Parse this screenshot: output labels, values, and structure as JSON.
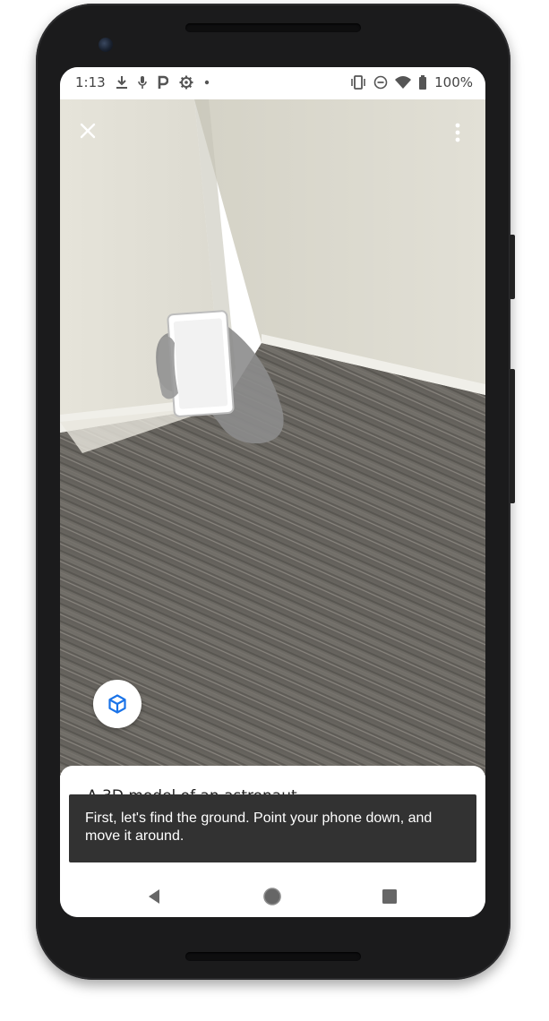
{
  "status_bar": {
    "time": "1:13",
    "left_icons": [
      "download-icon",
      "mic-icon",
      "parking-icon",
      "settings-icon",
      "dot-icon"
    ],
    "right_icons": [
      "vibrate-icon",
      "do-not-disturb-icon",
      "wifi-icon",
      "battery-icon"
    ],
    "battery": "100%"
  },
  "ar_view": {
    "close_icon": "close-icon",
    "more_icon": "more-vert-icon",
    "view_3d_icon": "cube-icon",
    "accent_color": "#1a73e8",
    "hint_graphic": "hand-holding-phone"
  },
  "bottom_sheet": {
    "title": "A 3D model of an astronaut"
  },
  "toast": {
    "message": "First, let's find the ground. Point your phone down, and move it around."
  },
  "nav_bar": {
    "back_icon": "back-triangle-icon",
    "home_icon": "home-circle-icon",
    "recents_icon": "recents-square-icon"
  }
}
